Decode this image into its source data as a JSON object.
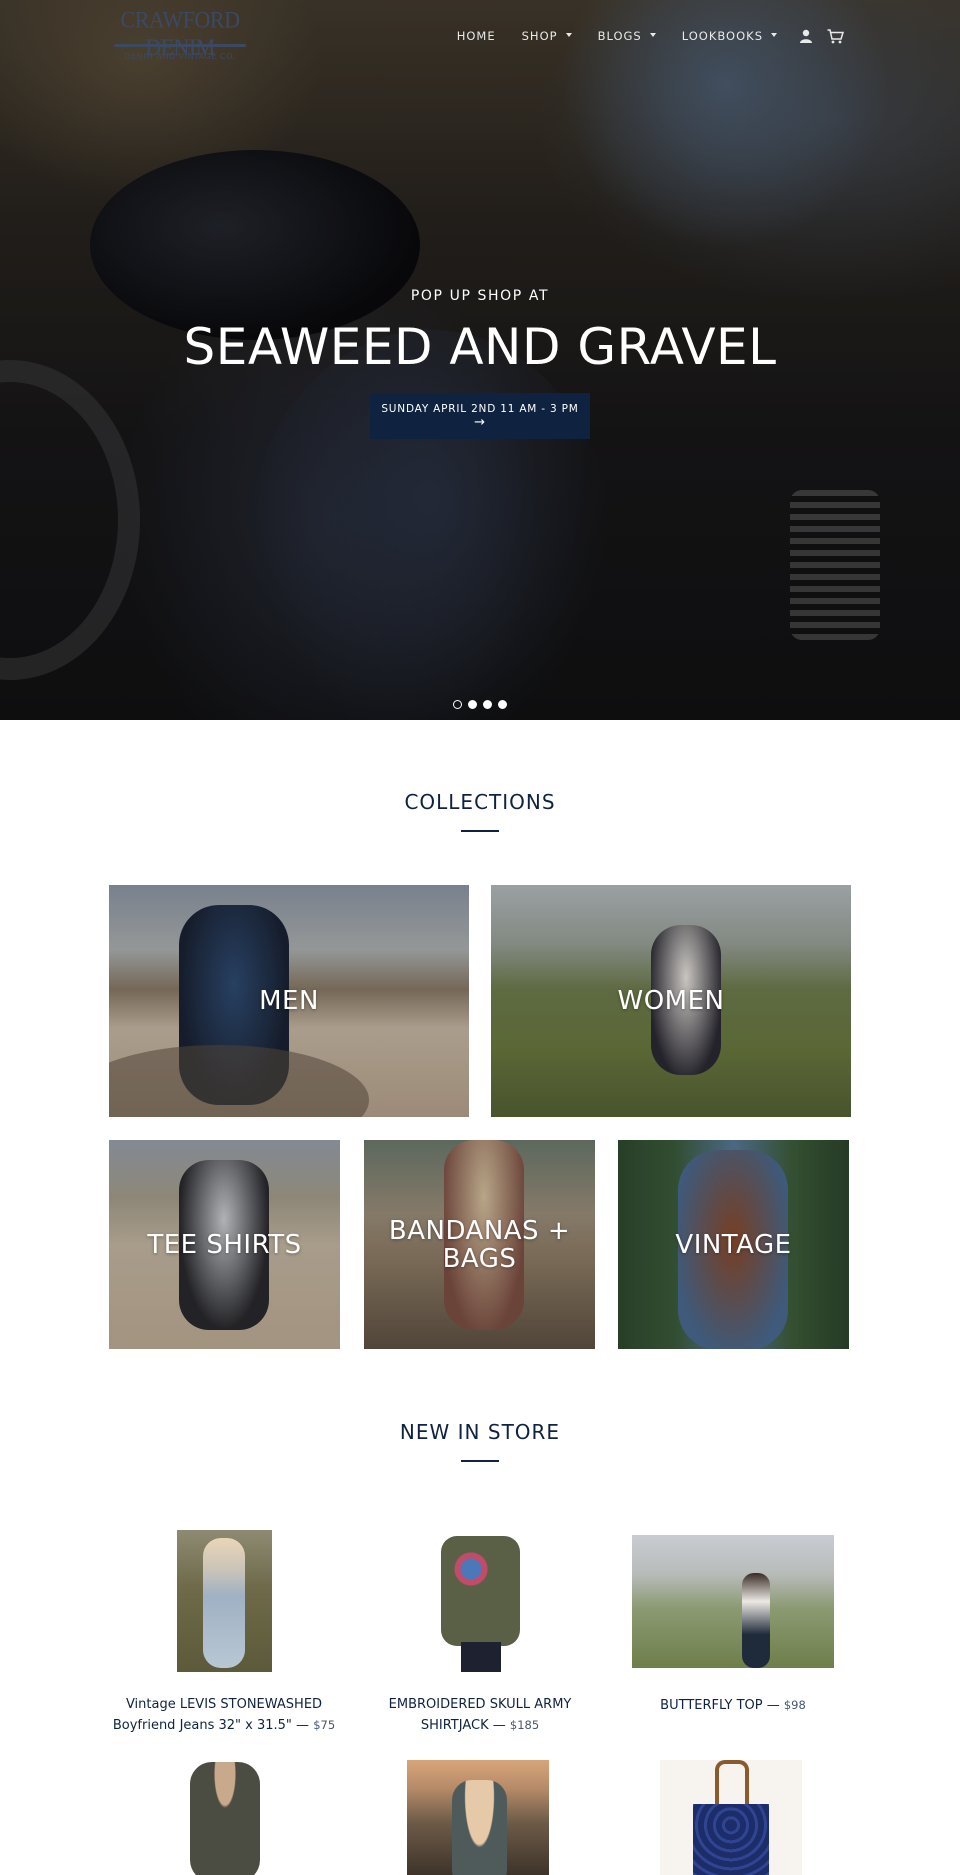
{
  "header": {
    "logo": {
      "main": "CRAWFORD DENIM",
      "sub": "DENIM AND VINTAGE CO."
    },
    "nav": [
      {
        "label": "HOME",
        "has_dropdown": false
      },
      {
        "label": "SHOP",
        "has_dropdown": true
      },
      {
        "label": "BLOGS",
        "has_dropdown": true
      },
      {
        "label": "LOOKBOOKS",
        "has_dropdown": true
      }
    ],
    "icons": [
      "account-icon",
      "cart-icon"
    ]
  },
  "hero": {
    "kicker": "POP UP SHOP AT",
    "title": "SEAWEED AND GRAVEL",
    "button_label": "SUNDAY APRIL 2ND 11 AM - 3 PM",
    "button_arrow": "→",
    "slides_count": 4,
    "active_slide": 1
  },
  "collections": {
    "title": "COLLECTIONS",
    "items": [
      {
        "label": "MEN"
      },
      {
        "label": "WOMEN"
      },
      {
        "label": "TEE SHIRTS"
      },
      {
        "label": "BANDANAS + BAGS"
      },
      {
        "label": "VINTAGE"
      }
    ]
  },
  "new_in_store": {
    "title": "NEW IN STORE",
    "products": [
      {
        "name": "Vintage LEVIS STONEWASHED Boyfriend Jeans 32\" x 31.5\"",
        "separator": " — ",
        "price": "$75"
      },
      {
        "name": "EMBROIDERED SKULL ARMY SHIRTJACK",
        "separator": " — ",
        "price": "$185"
      },
      {
        "name": "BUTTERFLY TOP",
        "separator": " — ",
        "price": "$98"
      }
    ]
  },
  "colors": {
    "navy": "#0f2340",
    "white": "#ffffff"
  }
}
